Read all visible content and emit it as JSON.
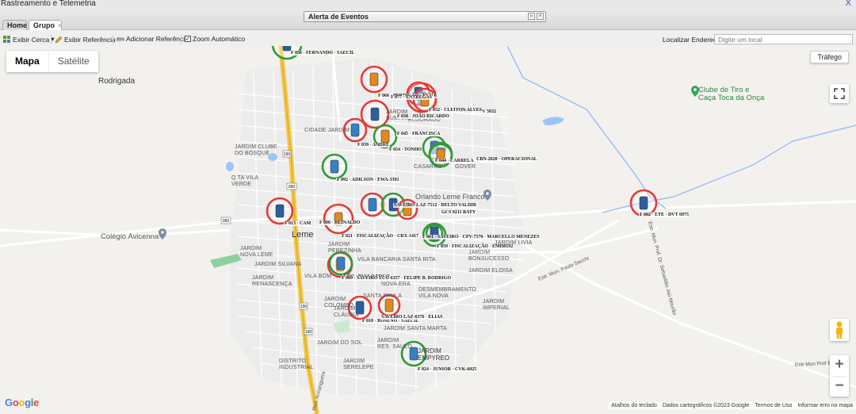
{
  "window": {
    "title": "Rastreamento e Telemetria",
    "close_icon": "x-icon"
  },
  "tabs": [
    {
      "label": "Home",
      "active": false
    },
    {
      "label": "Grupo",
      "active": true,
      "close": "×"
    }
  ],
  "events_panel": {
    "label": "Alerta de Eventos",
    "collapse": "»",
    "close": "×"
  },
  "toolbar": {
    "fence": "Exibir Cerca",
    "reference": "Exibir Referência",
    "add_reference": "Adicionar Referência",
    "auto_zoom": "Zoom Automático",
    "auto_zoom_checked": true,
    "dropdown_arrow": "▾",
    "checkmark": "✓"
  },
  "address": {
    "label": "Localizar Endereço:",
    "placeholder": "Digite um local",
    "value": ""
  },
  "map": {
    "type_map": "Mapa",
    "type_satellite": "Satélite",
    "traffic": "Tráfego",
    "zoom_in": "+",
    "zoom_out": "−",
    "google": "Google",
    "attribution": [
      "Atalhos do teclado",
      "Dados cartográficos ©2023 Google",
      "Termos de Uso",
      "Informar erro no mapa"
    ],
    "pois": {
      "tiro": "Clube de Tiro e\nCaça Toca da Onça",
      "avicenna": "Colégio Avicenna",
      "orlando": "Orlando Leme Franco"
    },
    "towns": {
      "rodrigada": "Rodrigada",
      "leme": "Leme"
    },
    "shields": [
      "050",
      "050",
      "190",
      "190",
      "190"
    ],
    "roads": {
      "anhanguera": "Rod. Anhanguera",
      "sebastiao": "Estr. Mun. Prof. Dr. Sebastião Jaú Mourão",
      "paulo": "Estr. Mun. Paulo Sacchi",
      "ernest": "Estr Mun Prof Ernest"
    },
    "neighborhoods": [
      "JARDIM CLUBE\nDO BOSQUE",
      "Q TA VILA\nVERDE",
      "JARDIM\nNOVA LEME",
      "JARDIM SILVANA",
      "JARDIM\nRENASCENÇA",
      "VILA BOM",
      "VILA BANCARIA SANTA RITA",
      "JARDIM\nBONSUCESSO",
      "JARDIM ELOISA",
      "JARDIM\nIMPERIAL",
      "DESMEMBRAMENTO\nVILA NOVA",
      "NOVA ERA",
      "JARDIM\nCOLOMBO",
      "JARDIM\nCLÁUDIA",
      "JARDIM SANTA MARTA",
      "JARDIM\nRES. SAULO",
      "JARDIM DO SOL",
      "DISTRITO\nINDUSTRIAL",
      "JARDIM\nSERELEPE",
      "JARDIM\nEMPYREO",
      "CIDADE JARDIM",
      "JARDIM\nSUMARE",
      "ELDORADO",
      "JARDIM\nPEREZINHA",
      "SANTA PAULA",
      "JARDIM LIVIA",
      "CASARÃO",
      "GOVER"
    ],
    "vehicles": [
      {
        "label": "F 056 · FERNANDO · SAECIL",
        "ring": "green"
      },
      {
        "label": "F 066 · PERDIGÃO · ECO 0",
        "ring": "red"
      },
      {
        "label": "F 077 · ENTREGAS",
        "ring": "red"
      },
      {
        "label": "F 075 · CTV 5832",
        "ring": "red"
      },
      {
        "label": "F 038 · JOÃO RICARDO",
        "ring": "red"
      },
      {
        "label": "F 039 · ANDRE",
        "ring": "red"
      },
      {
        "label": "F 052 · CLEITON ALVES",
        "ring": "red"
      },
      {
        "label": "F 045 · FRANCISCA",
        "ring": "green"
      },
      {
        "label": "F 054 · TONHO",
        "ring": "green"
      },
      {
        "label": "F 044 · CARRELA",
        "ring": "green"
      },
      {
        "label": "CBN-2020 · OPERACIONAL",
        "ring": "green"
      },
      {
        "label": "F 092 · ADILSON · EWA-3391",
        "ring": "green"
      },
      {
        "label": "F 013 · CAM",
        "ring": "red"
      },
      {
        "label": "F 006 · REINALDO",
        "ring": "red"
      },
      {
        "label": "F 021 · FISCALIZAÇÃO · CRX-1417",
        "ring": "red"
      },
      {
        "label": "SAVEIRO LAZ-7512 · DELTO VALDIR",
        "ring": "green"
      },
      {
        "label": "GCS 8211 BATY",
        "ring": "red"
      },
      {
        "label": "F 061 · SAVEIRO · CPV-7570 · MARCELLO MENEZES",
        "ring": "green"
      },
      {
        "label": "F 059 · FISCALIZAÇÃO · EMH8192",
        "ring": "green"
      },
      {
        "label": "F 033 · PAULO FOGO",
        "ring": "red"
      },
      {
        "label": "F 009 · SAVEIRO ECO 6357 · FELIPE B. RODRIGO",
        "ring": "green"
      },
      {
        "label": "F 018 · ROSENO · SAECIL",
        "ring": "red"
      },
      {
        "label": "SAVEIRO LAZ-6376 · ELIAS",
        "ring": "red"
      },
      {
        "label": "F 024 · JUNIOR · CVK-6025",
        "ring": "green"
      },
      {
        "label": "F 002 · ETE · DVT 6975",
        "ring": "red"
      }
    ]
  }
}
